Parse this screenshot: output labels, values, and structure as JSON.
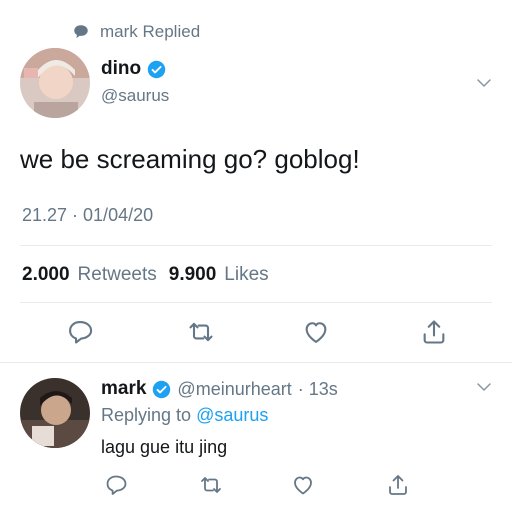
{
  "context": {
    "text": "mark Replied"
  },
  "main_tweet": {
    "name": "dino",
    "handle": "@saurus",
    "text": "we be screaming go? goblog!",
    "time": "21.27 · 01/04/20",
    "retweets_count": "2.000",
    "retweets_label": "Retweets",
    "likes_count": "9.900",
    "likes_label": "Likes"
  },
  "reply_tweet": {
    "name": "mark",
    "handle": "@meinurheart",
    "time": "· 13s",
    "replying_prefix": "Replying to",
    "replying_to": "@saurus",
    "text": "lagu gue itu jing"
  },
  "colors": {
    "accent": "#1da1f2",
    "secondary_text": "#657786",
    "divider": "#e6ecf0"
  }
}
